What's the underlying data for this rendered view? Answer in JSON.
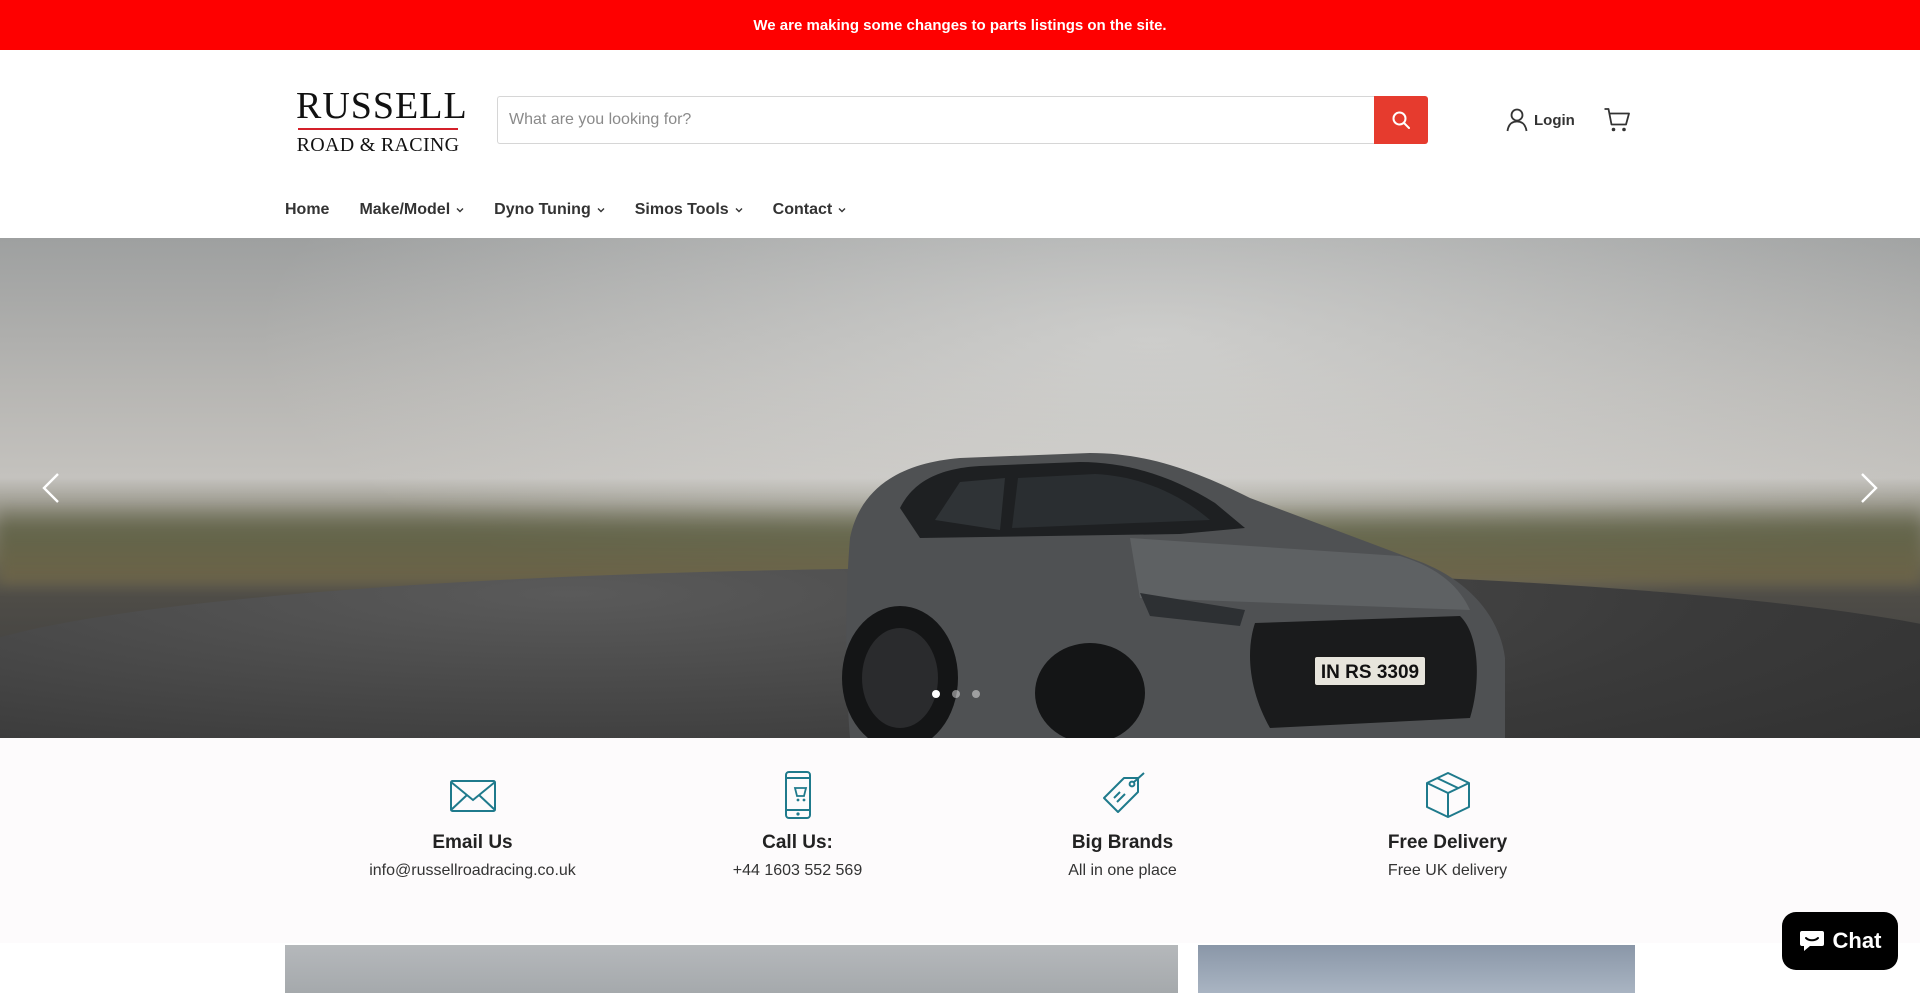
{
  "announcement": {
    "text": "We are making some changes to parts listings on the site."
  },
  "logo": {
    "line1": "RUSSELL",
    "line2": "ROAD & RACING",
    "rule_color": "#d4202a"
  },
  "search": {
    "placeholder": "What are you looking for?",
    "value": "",
    "button_icon": "search-icon",
    "button_color": "#e63b2e"
  },
  "account": {
    "login_label": "Login",
    "icon": "user-icon"
  },
  "cart": {
    "icon": "cart-icon"
  },
  "nav": {
    "items": [
      {
        "label": "Home",
        "has_dropdown": false
      },
      {
        "label": "Make/Model",
        "has_dropdown": true
      },
      {
        "label": "Dyno Tuning",
        "has_dropdown": true
      },
      {
        "label": "Simos Tools",
        "has_dropdown": true
      },
      {
        "label": "Contact",
        "has_dropdown": true
      }
    ]
  },
  "hero": {
    "image": "car-photo",
    "plate_text": "IN RS 3309",
    "prev_icon": "chevron-left-icon",
    "next_icon": "chevron-right-icon",
    "slides_count": 3,
    "active_slide": 1
  },
  "features": [
    {
      "icon": "envelope-icon",
      "title": "Email Us",
      "text": "info@russellroadracing.co.uk"
    },
    {
      "icon": "mobile-phone-icon",
      "title": "Call Us:",
      "text": "+44 1603 552 569"
    },
    {
      "icon": "price-tag-icon",
      "title": "Big Brands",
      "text": "All in one place"
    },
    {
      "icon": "box-icon",
      "title": "Free Delivery",
      "text": "Free UK delivery"
    }
  ],
  "chat": {
    "label": "Chat",
    "icon": "chat-bubble-icon"
  },
  "colors": {
    "announcement_bg": "#fe0000",
    "accent": "#e63b2e",
    "feature_icon": "#1f7a8c"
  }
}
